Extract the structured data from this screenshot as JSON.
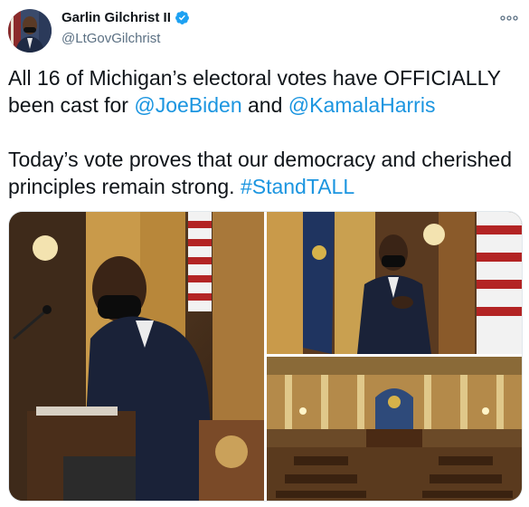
{
  "author": {
    "display_name": "Garlin Gilchrist II",
    "handle": "@LtGovGilchrist",
    "verified": true,
    "avatar_icon": "profile-avatar"
  },
  "menu": {
    "icon": "more-horizontal-icon"
  },
  "tweet": {
    "line1_prefix": "All 16 of Michigan’s electoral votes have OFFICIALLY been cast for ",
    "mention1": "@JoeBiden",
    "and_text": " and ",
    "mention2": "@KamalaHarris",
    "line2_prefix": "Today’s vote proves that our democracy and cherished principles remain strong. ",
    "hashtag": "#StandTALL"
  },
  "colors": {
    "link": "#1b95e0",
    "text": "#0f1419",
    "secondary": "#5b7083",
    "verified": "#1da1f2"
  },
  "media": {
    "photos": [
      {
        "icon": "photo-man-signing-document"
      },
      {
        "icon": "photo-man-hand-on-heart-flag"
      },
      {
        "icon": "photo-senate-chamber-overview"
      }
    ]
  }
}
